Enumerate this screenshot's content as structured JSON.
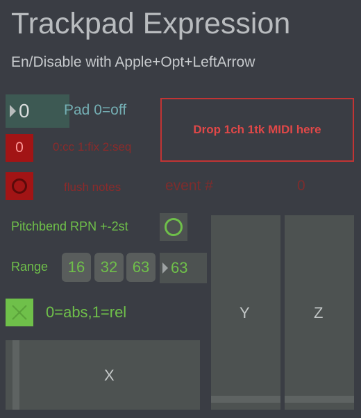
{
  "header": {
    "title": "Trackpad Expression",
    "subtitle": "En/Disable with Apple+Opt+LeftArrow"
  },
  "pad": {
    "value": "0",
    "label": "Pad 0=off"
  },
  "mode": {
    "value": "0",
    "label": "0:cc 1:fix 2:seq"
  },
  "flush": {
    "label": "flush notes"
  },
  "event": {
    "label": "event #",
    "value": "0"
  },
  "dropzone": {
    "label": "Drop 1ch 1tk MIDI here"
  },
  "pitchbend": {
    "label": "Pitchbend RPN +-2st"
  },
  "range": {
    "label": "Range",
    "buttons": [
      "16",
      "32",
      "63"
    ],
    "value": "63"
  },
  "absrel": {
    "label": "0=abs,1=rel"
  },
  "sliders": {
    "x": "X",
    "y": "Y",
    "z": "Z"
  },
  "colors": {
    "background": "#3a3d44",
    "accent_green": "#6fc04a",
    "accent_red": "#a21415",
    "teal": "#74aeb3"
  }
}
